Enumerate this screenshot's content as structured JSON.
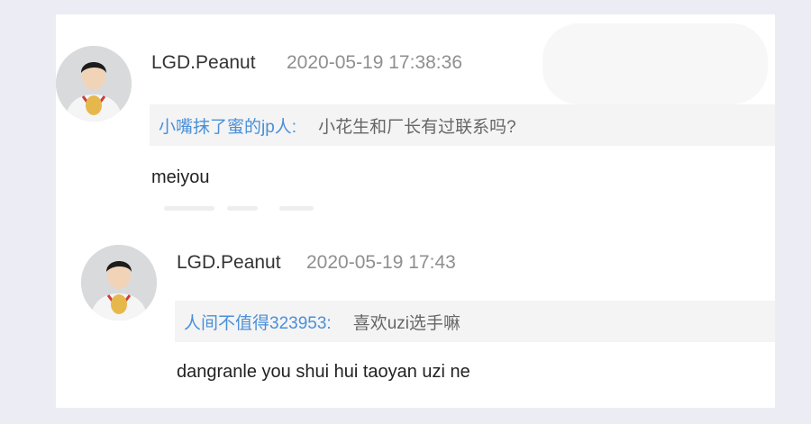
{
  "comments": [
    {
      "username": "LGD.Peanut",
      "timestamp": "2020-05-19 17:38:36",
      "quote_user": "小嘴抹了蜜的jp人:",
      "quote_text": "小花生和厂长有过联系吗?",
      "reply": "meiyou"
    },
    {
      "username": "LGD.Peanut",
      "timestamp": "2020-05-19 17:43",
      "quote_user": "人间不值得323953:",
      "quote_text": "喜欢uzi选手嘛",
      "reply": "dangranle you shui hui taoyan uzi ne"
    }
  ],
  "colors": {
    "background": "#ecedf4",
    "card": "#ffffff",
    "quote_background": "#f4f4f4",
    "quote_user": "#4a8fd9",
    "username": "#333333",
    "timestamp": "#8f8f8f",
    "reply": "#222222"
  },
  "icons": {
    "avatar": "user-avatar-icon"
  }
}
